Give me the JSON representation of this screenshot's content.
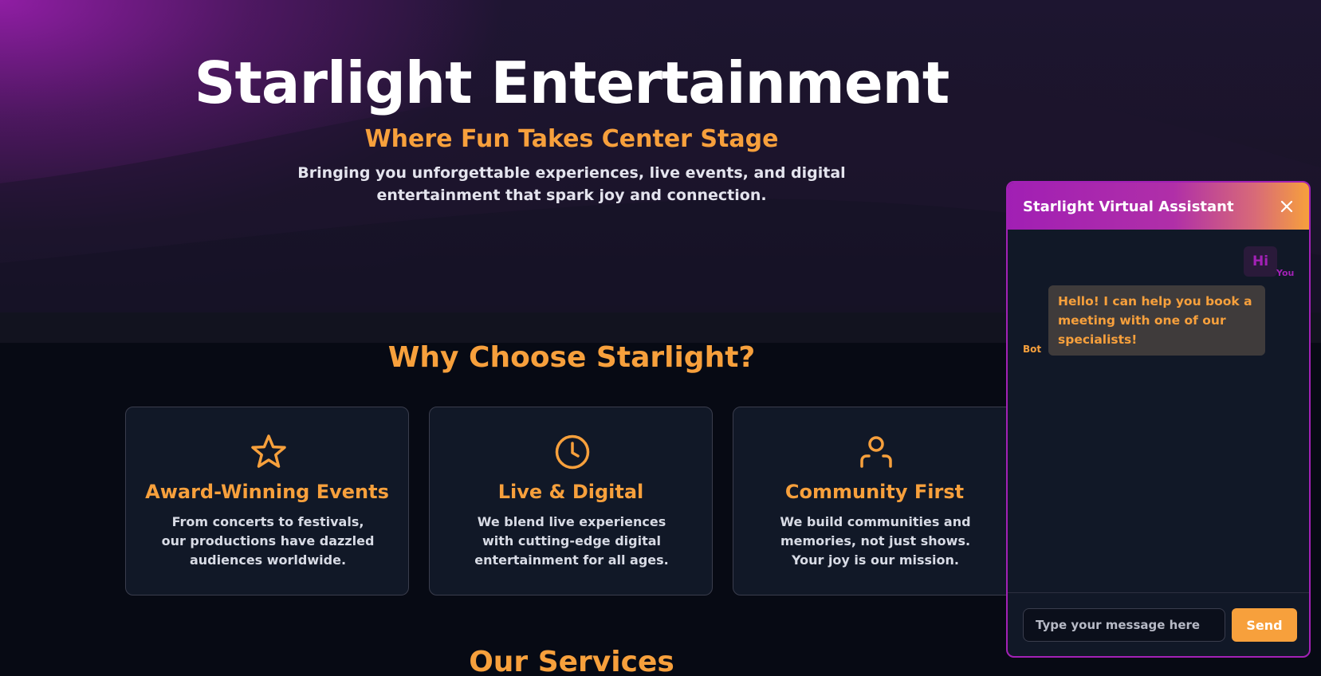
{
  "hero": {
    "title": "Starlight Entertainment",
    "subtitle": "Where Fun Takes Center Stage",
    "description": "Bringing you unforgettable experiences, live events, and digital entertainment that spark joy and connection."
  },
  "why": {
    "title": "Why Choose Starlight?",
    "cards": [
      {
        "icon": "star-icon",
        "title": "Award-Winning Events",
        "text": "From concerts to festivals, our productions have dazzled audiences worldwide."
      },
      {
        "icon": "clock-icon",
        "title": "Live & Digital",
        "text": "We blend live experiences with cutting-edge digital entertainment for all ages."
      },
      {
        "icon": "user-icon",
        "title": "Community First",
        "text": "We build communities and memories, not just shows. Your joy is our mission."
      }
    ]
  },
  "services": {
    "title": "Our Services"
  },
  "chat": {
    "title": "Starlight Virtual Assistant",
    "close_icon": "close-icon",
    "messages": [
      {
        "sender": "You",
        "text": "Hi"
      },
      {
        "sender": "Bot",
        "text": "Hello! I can help you book a meeting with one of our specialists!"
      }
    ],
    "input_placeholder": "Type your message here",
    "input_value": "",
    "send_label": "Send"
  },
  "colors": {
    "accent": "#f7a03c",
    "brand_purple": "#a321b6",
    "background": "#070a14",
    "card_background": "#111827"
  }
}
